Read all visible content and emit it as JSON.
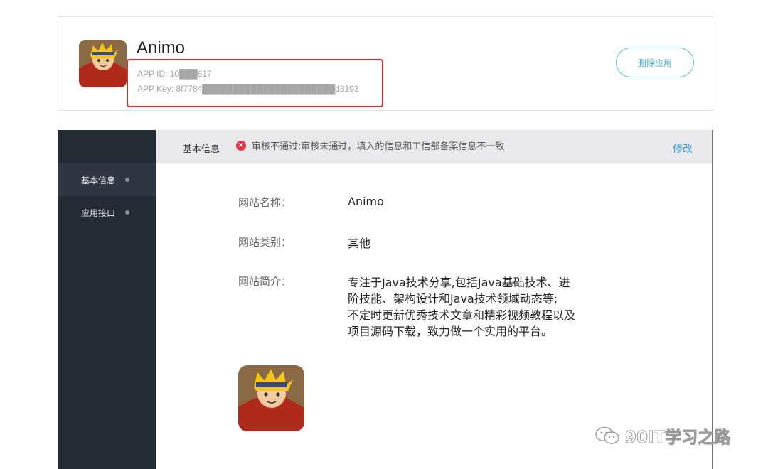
{
  "app": {
    "name": "Animo",
    "app_id": "APP ID:  10███617",
    "app_key": "APP Key:  8f7784██████████████████████d3193",
    "delete_label": "删除应用"
  },
  "sidebar": {
    "items": [
      {
        "label": "基本信息",
        "active": true
      },
      {
        "label": "应用接口",
        "active": false
      }
    ]
  },
  "topbar": {
    "section_label": "基本信息",
    "error_text": "审核不通过:审核未通过，填入的信息和工信部备案信息不一致",
    "edit_label": "修改"
  },
  "fields": {
    "name_label": "网站名称：",
    "name_value": "Animo",
    "category_label": "网站类别：",
    "category_value": "其他",
    "intro_label": "网站简介：",
    "intro_lines": [
      "专注于Java技术分享,包括Java基础技术、进",
      "阶技能、架构设计和Java技术领域动态等;",
      "不定时更新优秀技术文章和精彩视频教程以及",
      "项目源码下载，致力做一个实用的平台。"
    ]
  },
  "watermark": {
    "text": "90IT学习之路",
    "icon": "wechat-icon"
  },
  "colors": {
    "accent": "#4aa8c4",
    "error": "#e2344a",
    "sidebar": "#232b35",
    "highlight_box": "#d92b2b"
  }
}
